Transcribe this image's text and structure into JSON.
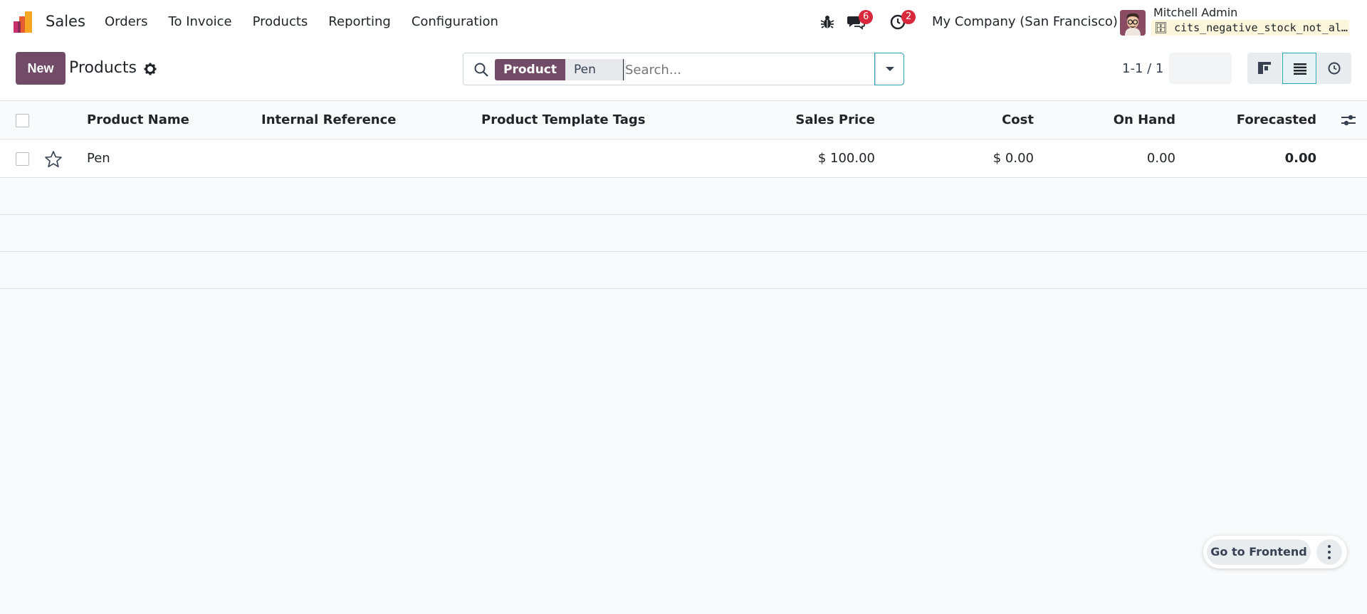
{
  "navbar": {
    "app_name": "Sales",
    "menu": [
      "Orders",
      "To Invoice",
      "Products",
      "Reporting",
      "Configuration"
    ],
    "chat_count": "6",
    "activity_count": "2",
    "company": "My Company (San Francisco)",
    "user_name": "Mitchell Admin",
    "database": "cits_negative_stock_not_allowed"
  },
  "control": {
    "new_label": "New",
    "title": "Products",
    "facet_label": "Product",
    "facet_value": "Pen",
    "search_placeholder": "Search...",
    "pager": "1-1 / 1"
  },
  "table": {
    "headers": {
      "name": "Product Name",
      "ref": "Internal Reference",
      "tags": "Product Template Tags",
      "price": "Sales Price",
      "cost": "Cost",
      "onhand": "On Hand",
      "forecast": "Forecasted"
    },
    "rows": [
      {
        "name": "Pen",
        "ref": "",
        "tags": "",
        "price": "$ 100.00",
        "cost": "$ 0.00",
        "onhand": "0.00",
        "forecast": "0.00"
      }
    ]
  },
  "footer": {
    "frontend_label": "Go to Frontend"
  },
  "colors": {
    "primary": "#714b67",
    "badge": "#d9273b",
    "accent": "#2ba5b4"
  }
}
